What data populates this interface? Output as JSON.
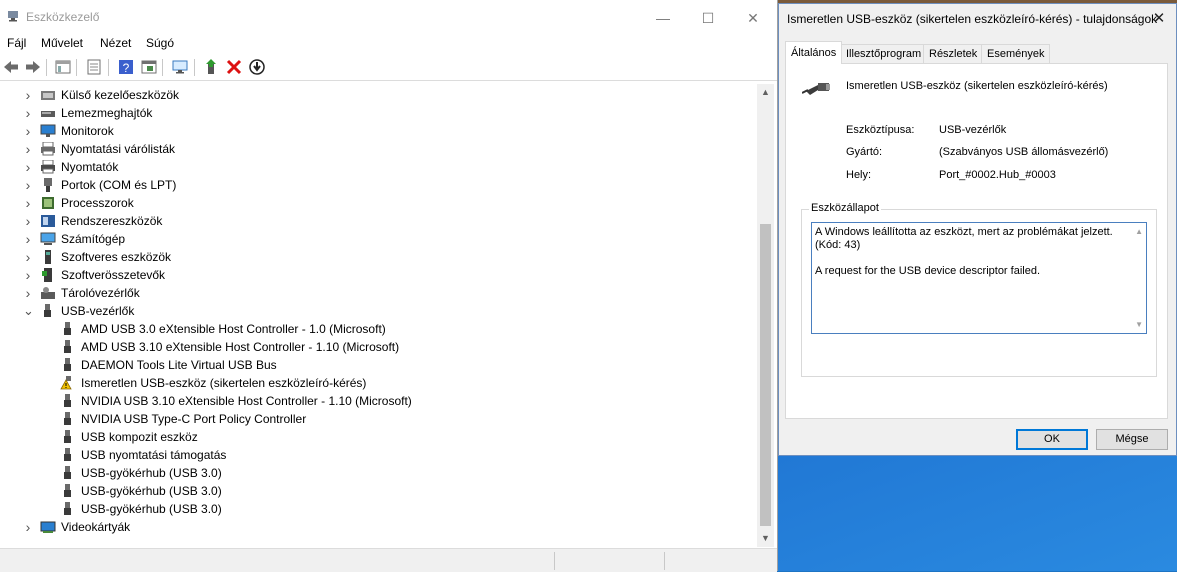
{
  "device_manager": {
    "title": "Eszközkezelő",
    "caption_buttons": {
      "minimize": "—",
      "maximize": "☐",
      "close": "✕"
    },
    "menu": [
      "Fájl",
      "Művelet",
      "Nézet",
      "Súgó"
    ],
    "tree": [
      {
        "label": "Külső kezelőeszközök",
        "icon": "hid-icon",
        "expanded": false
      },
      {
        "label": "Lemezmeghajtók",
        "icon": "disk-drive-icon",
        "expanded": false
      },
      {
        "label": "Monitorok",
        "icon": "monitor-icon",
        "expanded": false
      },
      {
        "label": "Nyomtatási várólisták",
        "icon": "print-queue-icon",
        "expanded": false
      },
      {
        "label": "Nyomtatók",
        "icon": "printer-icon",
        "expanded": false
      },
      {
        "label": "Portok (COM és LPT)",
        "icon": "port-icon",
        "expanded": false
      },
      {
        "label": "Processzorok",
        "icon": "processor-icon",
        "expanded": false
      },
      {
        "label": "Rendszereszközök",
        "icon": "system-device-icon",
        "expanded": false
      },
      {
        "label": "Számítógép",
        "icon": "computer-icon",
        "expanded": false
      },
      {
        "label": "Szoftveres eszközök",
        "icon": "software-device-icon",
        "expanded": false
      },
      {
        "label": "Szoftverösszetevők",
        "icon": "software-component-icon",
        "expanded": false
      },
      {
        "label": "Tárolóvezérlők",
        "icon": "storage-controller-icon",
        "expanded": false
      },
      {
        "label": "USB-vezérlők",
        "icon": "usb-icon",
        "expanded": true
      },
      {
        "label": "AMD USB 3.0 eXtensible Host Controller - 1.0 (Microsoft)",
        "icon": "usb-icon",
        "child": true
      },
      {
        "label": "AMD USB 3.10 eXtensible Host Controller - 1.10 (Microsoft)",
        "icon": "usb-icon",
        "child": true
      },
      {
        "label": "DAEMON Tools Lite Virtual USB Bus",
        "icon": "usb-icon",
        "child": true
      },
      {
        "label": "Ismeretlen USB-eszköz (sikertelen eszközleíró-kérés)",
        "icon": "warning-icon",
        "child": true
      },
      {
        "label": "NVIDIA USB 3.10 eXtensible Host Controller - 1.10 (Microsoft)",
        "icon": "usb-icon",
        "child": true
      },
      {
        "label": "NVIDIA USB Type-C Port Policy Controller",
        "icon": "usb-icon",
        "child": true
      },
      {
        "label": "USB kompozit eszköz",
        "icon": "usb-icon",
        "child": true
      },
      {
        "label": "USB nyomtatási támogatás",
        "icon": "usb-icon",
        "child": true
      },
      {
        "label": "USB-gyökérhub (USB 3.0)",
        "icon": "usb-icon",
        "child": true
      },
      {
        "label": "USB-gyökérhub (USB 3.0)",
        "icon": "usb-icon",
        "child": true
      },
      {
        "label": "USB-gyökérhub (USB 3.0)",
        "icon": "usb-icon",
        "child": true
      },
      {
        "label": "Videokártyák",
        "icon": "display-adapter-icon",
        "expanded": false
      }
    ]
  },
  "properties_dialog": {
    "title": "Ismeretlen USB-eszköz (sikertelen eszközleíró-kérés) - tulajdonságok",
    "tabs": [
      "Általános",
      "Illesztőprogram",
      "Részletek",
      "Események"
    ],
    "active_tab": "Általános",
    "device_name": "Ismeretlen USB-eszköz (sikertelen eszközleíró-kérés)",
    "properties": [
      {
        "label": "Eszköztípusa:",
        "value": "USB-vezérlők"
      },
      {
        "label": "Gyártó:",
        "value": "(Szabványos USB állomásvezérlő)"
      },
      {
        "label": "Hely:",
        "value": "Port_#0002.Hub_#0003"
      }
    ],
    "status_group_label": "Eszközállapot",
    "status_line1": "A Windows leállította az eszközt, mert az problémákat jelzett. (Kód: 43)",
    "status_line2": "A request for the USB device descriptor failed.",
    "buttons": {
      "ok": "OK",
      "cancel": "Mégse"
    }
  }
}
